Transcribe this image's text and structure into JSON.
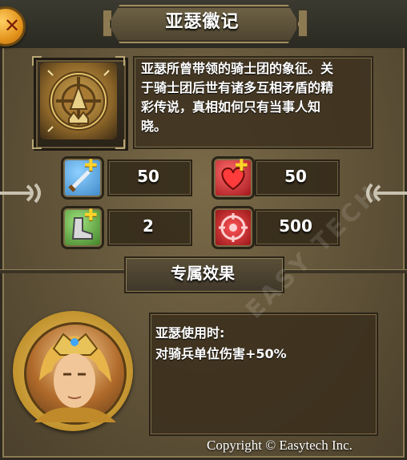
{
  "header": {
    "title": "亚瑟徽记"
  },
  "item": {
    "name": "亚瑟徽记",
    "description_lines": [
      "亚瑟所曾带领的骑士团的象征。关",
      "于骑士团后世有诸多互相矛盾的精",
      "彩传说，真相如何只有当事人知",
      "晓。"
    ]
  },
  "stats": [
    {
      "icon": "sword-icon",
      "value": "50",
      "color": "#5aa8e6"
    },
    {
      "icon": "heart-icon",
      "value": "50",
      "color": "#c8232a"
    },
    {
      "icon": "boot-icon",
      "value": "2",
      "color": "#4aa032"
    },
    {
      "icon": "target-icon",
      "value": "500",
      "color": "#d0262a"
    }
  ],
  "exclusive": {
    "title": "专属效果",
    "condition": "亚瑟使用时:",
    "effect": "对骑兵单位伤害+50%"
  },
  "watermark": "EASY TECH",
  "copyright": "Copyright © Easytech Inc.",
  "colors": {
    "accent": "#ffd42a",
    "panel": "#5f5238"
  }
}
